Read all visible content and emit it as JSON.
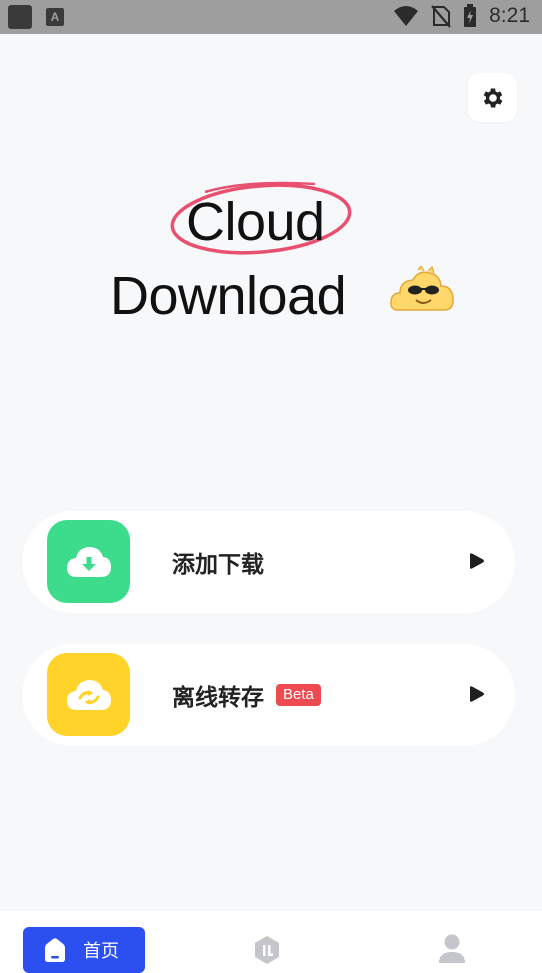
{
  "status_bar": {
    "time": "8:21",
    "left_icons": [
      "app-square-icon",
      "a-letter-icon"
    ],
    "right_icons": [
      "wifi-icon",
      "no-sim-icon",
      "battery-charging-icon"
    ],
    "a_glyph": "A"
  },
  "header": {
    "settings_icon": "gear-icon"
  },
  "hero": {
    "line1": "Cloud",
    "line2": "Download",
    "mascot_icon": "cloud-sunglasses-mascot",
    "circle_color": "#e8506f"
  },
  "actions": [
    {
      "label": "添加下载",
      "icon": "cloud-download-icon",
      "icon_bg": "#3ddc8c",
      "arrow": "play-arrow-icon"
    },
    {
      "label": "离线转存",
      "badge": "Beta",
      "icon": "cloud-sync-icon",
      "icon_bg": "#ffd329",
      "arrow": "play-arrow-icon"
    }
  ],
  "bottom_nav": {
    "items": [
      {
        "label": "首页",
        "icon": "home-icon",
        "active": true
      },
      {
        "label": "",
        "icon": "hexagon-logo-icon",
        "active": false
      },
      {
        "label": "",
        "icon": "user-icon",
        "active": false
      }
    ]
  },
  "colors": {
    "accent": "#2c4ff0",
    "background": "#f7f8fa",
    "beta_badge": "#ef4a4f"
  }
}
